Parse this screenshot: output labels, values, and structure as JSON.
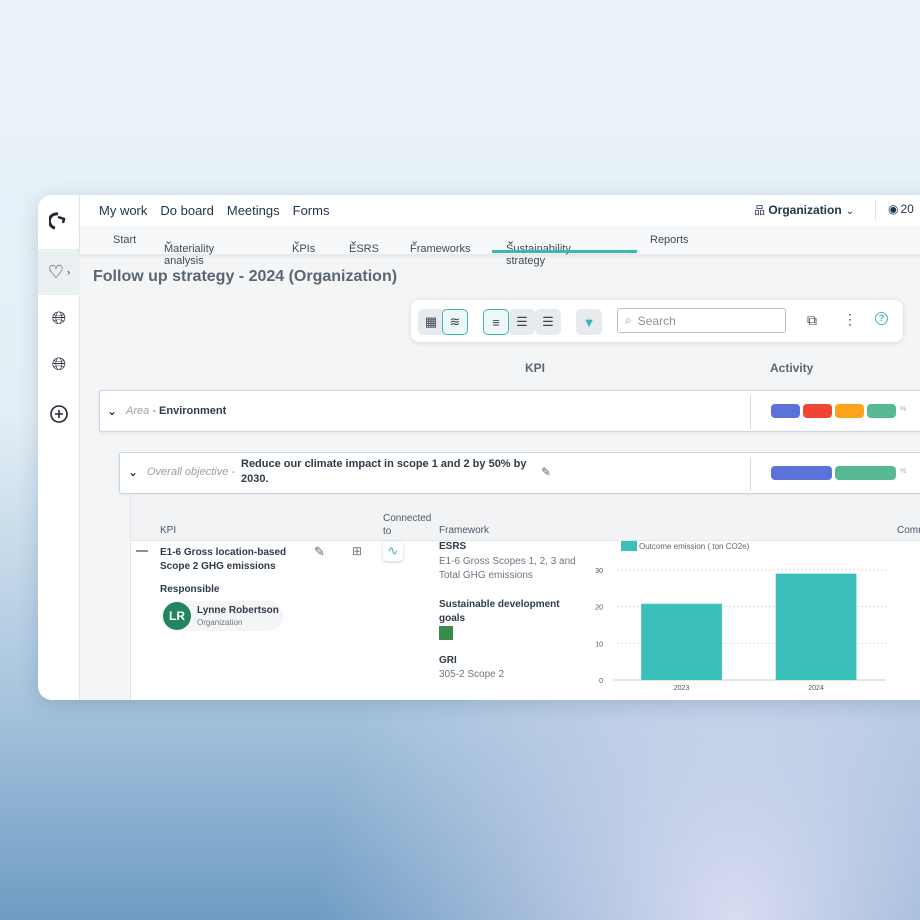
{
  "topnav": {
    "items": [
      "My work",
      "Do board",
      "Meetings",
      "Forms"
    ],
    "org_label": "Organization",
    "year_partial": "20"
  },
  "subnav": {
    "items": [
      "Start",
      "Materiality analysis",
      "KPIs",
      "ESRS",
      "Frameworks",
      "Sustainability strategy",
      "Reports"
    ],
    "active": "Sustainability strategy",
    "accent": "#3bb8b4"
  },
  "page": {
    "title": "Follow up strategy - 2024 (Organization)"
  },
  "toolbar": {
    "search_placeholder": "Search"
  },
  "table": {
    "kpi_header": "KPI",
    "activity_header": "Activity"
  },
  "area": {
    "label": "Area",
    "name": "Environment",
    "pills": [
      "#5b73d9",
      "#f04535",
      "#fca21c",
      "#57b894"
    ],
    "pct": "%"
  },
  "objective": {
    "label": "Overall objective",
    "text": "Reduce our climate impact in scope 1 and 2 by 50% by 2030.",
    "pills": [
      "#5b73d9",
      "#57b894"
    ],
    "pct": "%"
  },
  "kpi_table": {
    "headers": {
      "kpi": "KPI",
      "connected": "Connected to",
      "framework": "Framework",
      "comments": "Comm"
    },
    "kpi_name": "E1-6 Gross location-based Scope 2 GHG emissions",
    "responsible_label": "Responsible",
    "person": {
      "initials": "LR",
      "name": "Lynne Robertson",
      "org": "Organization"
    },
    "frameworks": [
      {
        "name": "ESRS",
        "detail": "E1-6 Gross Scopes 1, 2, 3 and Total GHG emissions"
      },
      {
        "name": "Sustainable development goals",
        "detail": ""
      },
      {
        "name": "GRI",
        "detail": "305-2 Scope 2"
      }
    ]
  },
  "chart_data": {
    "type": "bar",
    "categories": [
      "2023",
      "2024"
    ],
    "series": [
      {
        "name": "Outcome emission ( ton CO2e)",
        "values": [
          20.8,
          29
        ],
        "color": "#3bbfba"
      }
    ],
    "yticks": [
      0,
      10,
      20,
      30
    ],
    "ylim": [
      0,
      30
    ],
    "grid": true,
    "legend": "top-left"
  }
}
